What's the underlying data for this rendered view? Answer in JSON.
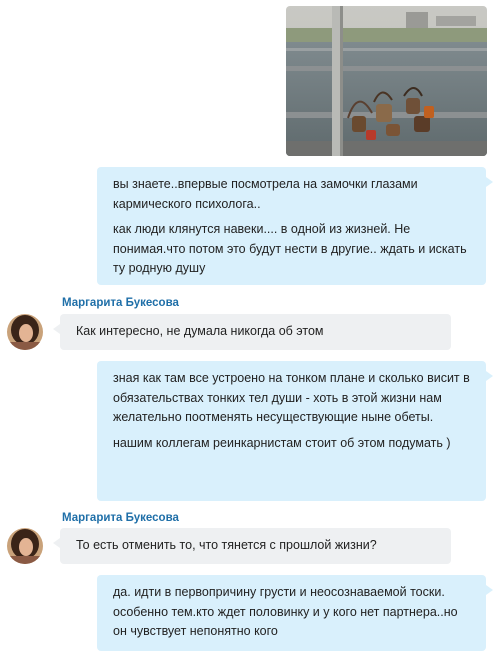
{
  "messages": {
    "m1": {
      "p1": "вы знаете..впервые посмотрела на замочки глазами кармического психолога..",
      "p2": "как люди клянутся навеки.... в одной из жизней. Не понимая.что потом это будут нести в другие.. ждать и искать ту родную душу"
    },
    "m2": {
      "sender": "Маргарита Букесова",
      "text": "Как интересно, не думала никогда об этом"
    },
    "m3": {
      "p1": "зная как там все устроено на тонком плане и сколько висит в обязательствах тонких тел души - хоть в этой жизни нам желательно поотменять несуществующие ныне обеты.",
      "p2": "нашим коллегам реинкарнистам стоит об этом подумать )"
    },
    "m4": {
      "sender": "Маргарита Букесова",
      "text": "То есть отменить то, что тянется с прошлой жизни?"
    },
    "m5": {
      "p1": "да. идти в первопричину грусти и неосознаваемой тоски. особенно тем.кто ждет половинку и у кого нет партнера..но он чувствует непонятно кого"
    }
  },
  "colors": {
    "outgoing_bubble": "#d9f0fc",
    "incoming_bubble": "#eef0f2",
    "sender_name": "#1f6fa8"
  }
}
